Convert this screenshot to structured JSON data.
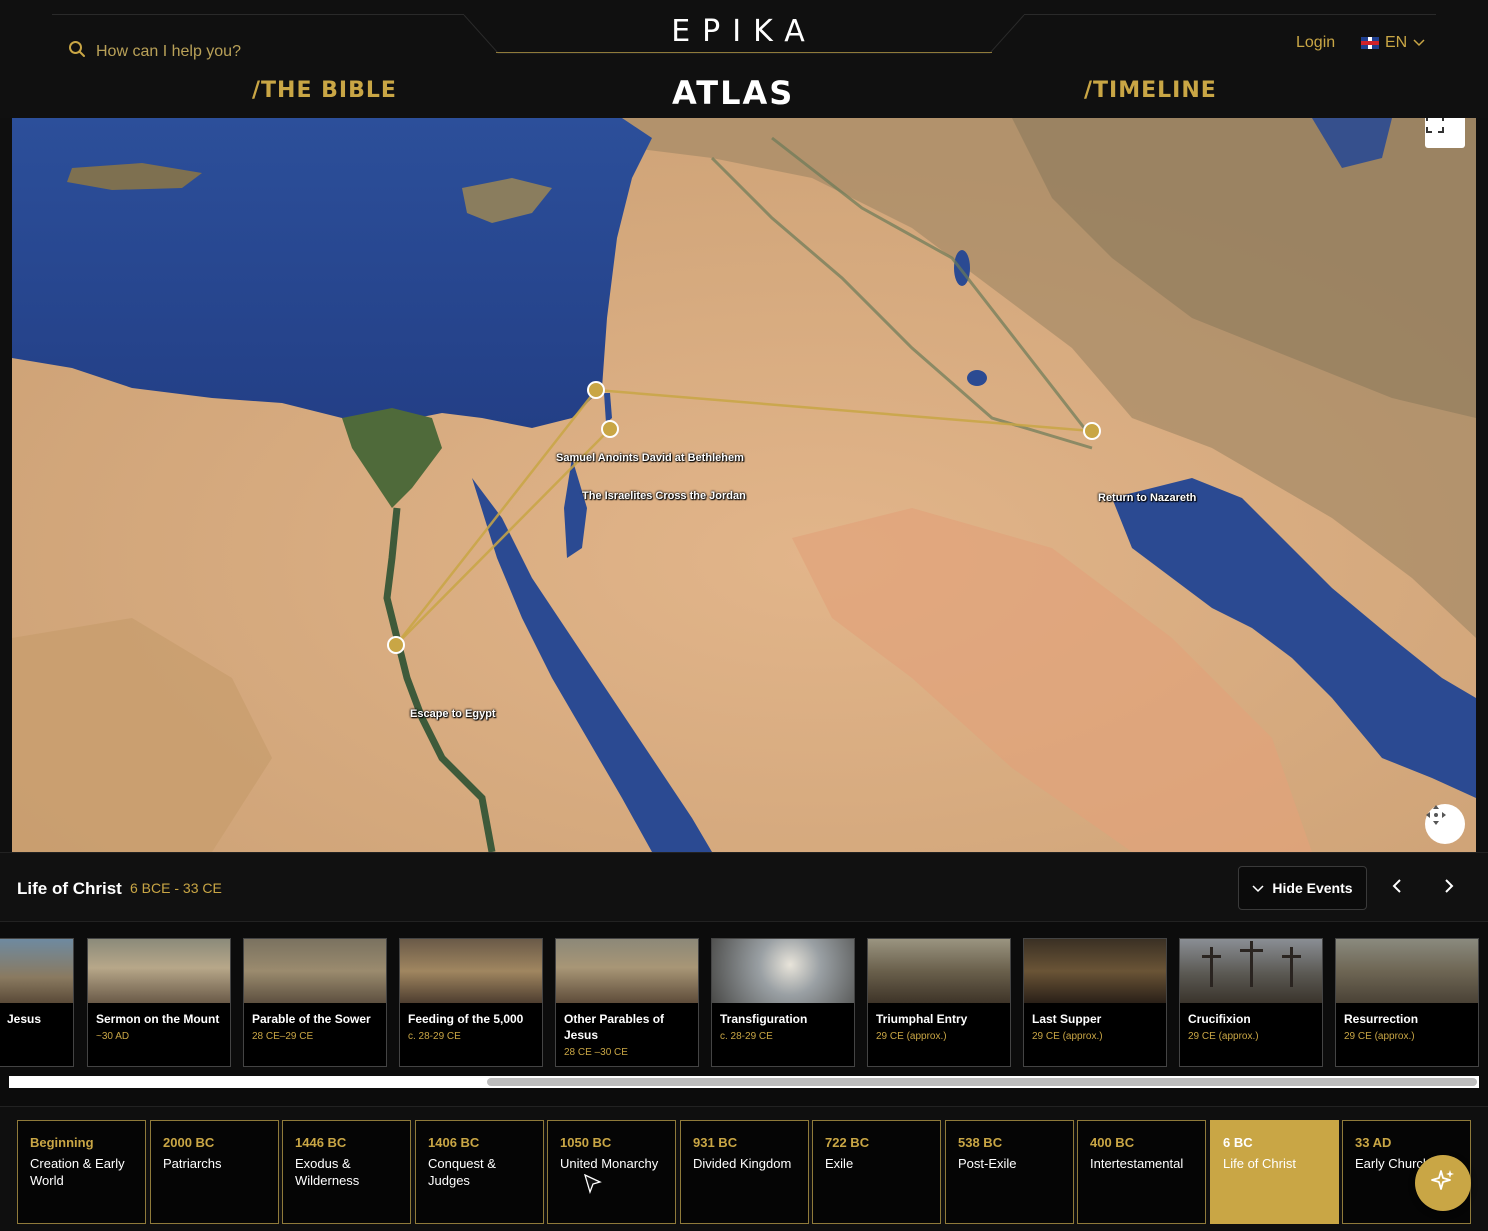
{
  "header": {
    "logo": "EPIKA",
    "search_placeholder": "How can I help you?",
    "login_label": "Login",
    "language": "EN",
    "nav": {
      "bible": "/THE BIBLE",
      "atlas": "ATLAS",
      "timeline": "/TIMELINE"
    }
  },
  "map": {
    "labels": {
      "samuel": "Samuel Anoints David at Bethlehem",
      "jordan": "The Israelites Cross the Jordan",
      "nazareth": "Return to Nazareth",
      "egypt": "Escape to Egypt"
    },
    "route_color": "#c9a645"
  },
  "events": {
    "era_title": "Life of Christ",
    "era_range": "6 BCE - 33 CE",
    "hide_events_label": "Hide Events",
    "cards": [
      {
        "title": "Jesus",
        "date": ""
      },
      {
        "title": "Sermon on the Mount",
        "date": "~30 AD"
      },
      {
        "title": "Parable of the Sower",
        "date": "28 CE–29 CE"
      },
      {
        "title": "Feeding of the 5,000",
        "date": "c. 28-29 CE"
      },
      {
        "title": "Other Parables of Jesus",
        "date": "28 CE –30 CE"
      },
      {
        "title": "Transfiguration",
        "date": "c. 28-29 CE"
      },
      {
        "title": "Triumphal Entry",
        "date": "29 CE (approx.)"
      },
      {
        "title": "Last Supper",
        "date": "29 CE (approx.)"
      },
      {
        "title": "Crucifixion",
        "date": "29 CE (approx.)"
      },
      {
        "title": "Resurrection",
        "date": "29 CE (approx.)"
      }
    ]
  },
  "eras": [
    {
      "year": "Beginning",
      "name": "Creation & Early World"
    },
    {
      "year": "2000 BC",
      "name": "Patriarchs"
    },
    {
      "year": "1446 BC",
      "name": "Exodus & Wilderness"
    },
    {
      "year": "1406 BC",
      "name": "Conquest & Judges"
    },
    {
      "year": "1050 BC",
      "name": "United Monarchy"
    },
    {
      "year": "931 BC",
      "name": "Divided Kingdom"
    },
    {
      "year": "722 BC",
      "name": "Exile"
    },
    {
      "year": "538 BC",
      "name": "Post-Exile"
    },
    {
      "year": "400 BC",
      "name": "Intertestamental"
    },
    {
      "year": "6 BC",
      "name": "Life of Christ"
    },
    {
      "year": "33 AD",
      "name": "Early Church"
    }
  ],
  "colors": {
    "accent": "#c9a645",
    "background": "#0f0f0f"
  }
}
